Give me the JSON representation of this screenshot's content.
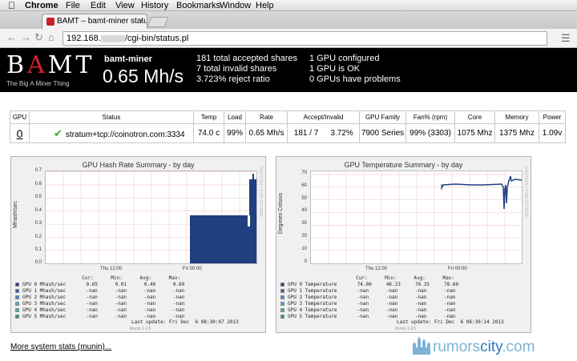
{
  "menubar": {
    "apple": "",
    "items": [
      "Chrome",
      "File",
      "Edit",
      "View",
      "History",
      "Bookmarks",
      "Window",
      "Help"
    ]
  },
  "tab": {
    "title": "BAMT – bamt-miner status",
    "close": "×"
  },
  "toolbar": {
    "back": "←",
    "forward": "→",
    "reload": "↻",
    "home": "⌂",
    "url_prefix": "192.168.",
    "url_suffix": "/cgi-bin/status.pl"
  },
  "header": {
    "logo_b": "B",
    "logo_a": "A",
    "logo_mt": "MT",
    "tagline": "The Big A Miner Thing",
    "hostname": "bamt-miner",
    "hashrate": "0.65 Mh/s",
    "stats_left": [
      "181 total accepted shares",
      "7 total invalid shares",
      "3.723% reject ratio"
    ],
    "stats_right": [
      "1 GPU configured",
      "1 GPU is OK",
      "0 GPUs have problems"
    ]
  },
  "table": {
    "headers": [
      "GPU",
      "Status",
      "Temp",
      "Load",
      "Rate",
      "Accept/Invalid",
      "GPU Family",
      "Fan% (rpm)",
      "Core",
      "Memory",
      "Power"
    ],
    "row": {
      "gpu": "0",
      "status": "stratum+tcp://coinotron.com:3334",
      "temp": "74.0 c",
      "load": "99%",
      "rate": "0.65 Mh/s",
      "accept": "181 / 7",
      "accept_pct": "3.72%",
      "family": "7900 Series",
      "fan": "99% (3303)",
      "core": "1075 Mhz",
      "memory": "1375 Mhz",
      "power": "1.09v"
    }
  },
  "graphs": {
    "hash": {
      "title": "GPU Hash Rate Summary - by day",
      "ylabel": "Mhash/sec",
      "rrdtool": "RRDTOOL / TOBI OETIKER",
      "yticks": [
        "0.7",
        "0.6",
        "0.5",
        "0.4",
        "0.3",
        "0.2",
        "0.1",
        "0.0"
      ],
      "xticks": [
        "Thu 12:00",
        "Fri 00:00"
      ],
      "legend_header": "                    Cur:      Min:      Avg:      Max:",
      "legend": [
        "GPU 0 Mhash/sec       0.65      0.01      0.40      0.69",
        "GPU 1 Mhash/sec       -nan      -nan      -nan      -nan",
        "GPU 2 Mhash/sec       -nan      -nan      -nan      -nan",
        "GPU 3 Mhash/sec       -nan      -nan      -nan      -nan",
        "GPU 4 Mhash/sec       -nan      -nan      -nan      -nan",
        "GPU 5 Mhash/sec       -nan      -nan      -nan      -nan"
      ],
      "last_update": "Last update: Fri Dec  6 08:30:07 2013",
      "munin": "Munin 1.4.5"
    },
    "temp": {
      "title": "GPU Temperature Summary - by day",
      "ylabel": "Degrees Celsius",
      "rrdtool": "RRDTOOL / TOBI OETIKER",
      "yticks": [
        "70",
        "60",
        "50",
        "40",
        "30",
        "20",
        "10",
        "0"
      ],
      "xticks": [
        "Thu 12:00",
        "Fri 00:00"
      ],
      "legend_header": "                       Cur:      Min:      Avg:      Max:",
      "legend": [
        "GPU 0 Temperature       74.00     46.23     70.35     78.60",
        "GPU 1 Temperature       -nan      -nan      -nan      -nan",
        "GPU 2 Temperature       -nan      -nan      -nan      -nan",
        "GPU 3 Temperature       -nan      -nan      -nan      -nan",
        "GPU 4 Temperature       -nan      -nan      -nan      -nan",
        "GPU 5 Temperature       -nan      -nan      -nan      -nan"
      ],
      "last_update": "Last update: Fri Dec  6 08:30:14 2013",
      "munin": "Munin 1.4.5"
    },
    "legend_colors": [
      "#1f3f7f",
      "#2b64b0",
      "#3f86d0",
      "#5aa5d8",
      "#3fb5a0",
      "#2f9f6f"
    ]
  },
  "footer": {
    "more_link": "More system stats (munin)...",
    "watermark_a": "rumors",
    "watermark_b": "city",
    "watermark_c": ".com"
  }
}
